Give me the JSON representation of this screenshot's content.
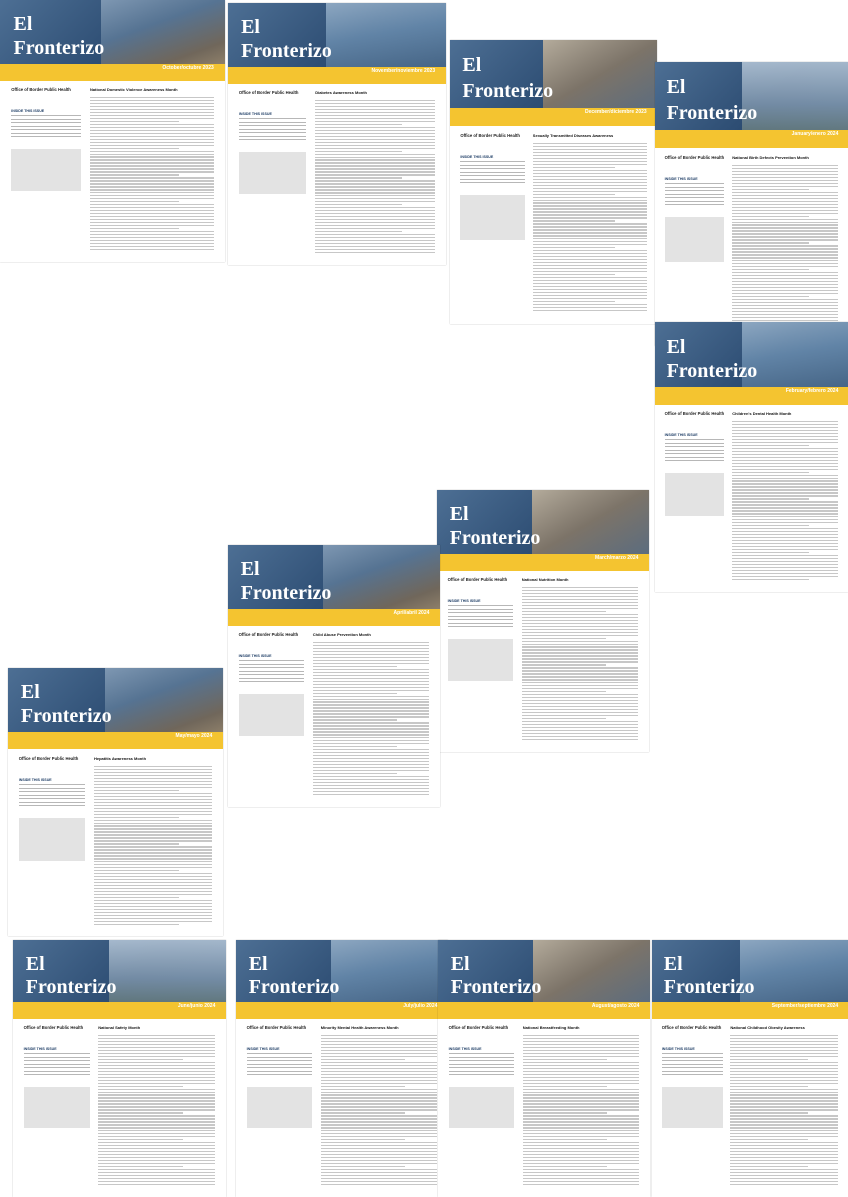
{
  "collage": {
    "newsletter_name_line1": "El",
    "newsletter_name_line2": "Fronterizo",
    "publisher": "Office of Border Public Health",
    "inside_heading": "INSIDE THIS ISSUE",
    "issues": [
      {
        "date": "October/octubre 2023",
        "article": "National Domestic Violence Awareness Month",
        "photo": "p1"
      },
      {
        "date": "November/noviembre 2023",
        "article": "Diabetes Awareness Month",
        "photo": "p2"
      },
      {
        "date": "December/diciembre 2023",
        "article": "Sexually Transmitted Diseases Awareness",
        "photo": "p3"
      },
      {
        "date": "January/enero 2024",
        "article": "National Birth Defects Prevention Month",
        "photo": "p4"
      },
      {
        "date": "February/febrero 2024",
        "article": "Children's Dental Health Month",
        "photo": "p2"
      },
      {
        "date": "March/marzo 2024",
        "article": "National Nutrition Month",
        "photo": "p3"
      },
      {
        "date": "April/abril 2024",
        "article": "Child Abuse Prevention Month",
        "photo": "p1"
      },
      {
        "date": "May/mayo 2024",
        "article": "Hepatitis Awareness Month",
        "photo": "p1"
      },
      {
        "date": "June/junio 2024",
        "article": "National Safety Month",
        "photo": "p4"
      },
      {
        "date": "July/julio 2024",
        "article": "Minority Mental Health Awareness Month",
        "photo": "p2"
      },
      {
        "date": "August/agosto 2024",
        "article": "National Breastfeeding Month",
        "photo": "p3"
      },
      {
        "date": "September/septiembre 2024",
        "article": "National Childhood Obesity Awareness",
        "photo": "p2"
      }
    ]
  }
}
